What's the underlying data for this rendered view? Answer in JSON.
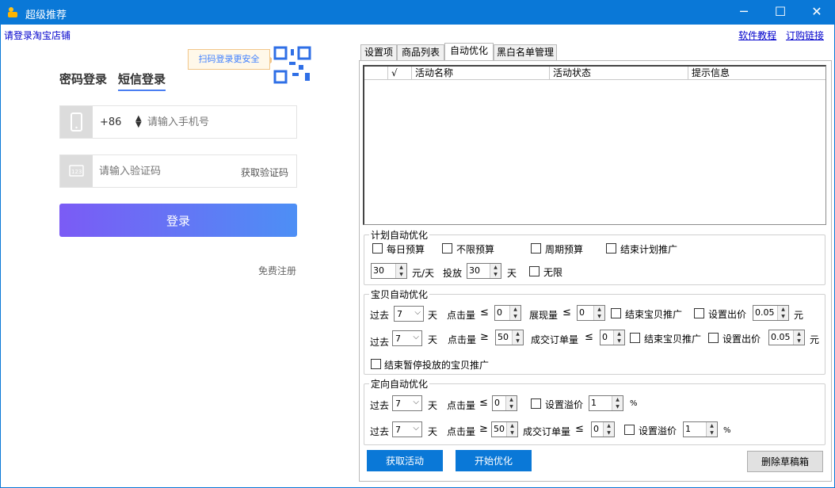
{
  "window": {
    "title": "超级推荐",
    "min": "─",
    "max": "☐",
    "close": "✕"
  },
  "header": {
    "login_link": "请登录淘宝店铺",
    "tutorial": "软件教程",
    "order": "订购链接"
  },
  "login": {
    "qr_tip": "扫码登录更安全",
    "tab_password": "密码登录",
    "tab_sms": "短信登录",
    "country_code": "+86",
    "phone_placeholder": "请输入手机号",
    "code_placeholder": "请输入验证码",
    "get_code": "获取验证码",
    "login_button": "登录",
    "register": "免费注册"
  },
  "tabs": [
    "设置项",
    "商品列表",
    "自动优化",
    "黑白名单管理"
  ],
  "grid": {
    "columns": [
      "",
      "√",
      "活动名称",
      "活动状态",
      "提示信息"
    ]
  },
  "plan": {
    "legend": "计划自动优化",
    "daily_budget": "每日预算",
    "unlimited_budget": "不限预算",
    "cycle_budget": "周期预算",
    "end_plan": "结束计划推广",
    "amount": "30",
    "unit_yuan_day": "元/天",
    "deliver": "投放",
    "days": "30",
    "unit_day": "天",
    "unlimited": "无限"
  },
  "item": {
    "legend": "宝贝自动优化",
    "past": "过去",
    "day": "天",
    "clicks": "点击量",
    "impressions": "展现量",
    "orders": "成交订单量",
    "end_item": "结束宝贝推广",
    "set_bid": "设置出价",
    "yuan": "元",
    "le": "≤",
    "ge": "≥",
    "row1": {
      "days": "7",
      "clicks": "0",
      "impressions": "0",
      "bid": "0.05"
    },
    "row2": {
      "days": "7",
      "clicks": "50",
      "orders": "0",
      "bid": "0.05"
    },
    "end_paused": "结束暂停投放的宝贝推广"
  },
  "target": {
    "legend": "定向自动优化",
    "past": "过去",
    "day": "天",
    "clicks": "点击量",
    "orders": "成交订单量",
    "set_premium": "设置溢价",
    "percent": "%",
    "le": "≤",
    "ge": "≥",
    "row1": {
      "days": "7",
      "clicks": "0",
      "premium": "1"
    },
    "row2": {
      "days": "7",
      "clicks": "50",
      "orders": "0",
      "premium": "1"
    }
  },
  "buttons": {
    "get_activity": "获取活动",
    "start_optimize": "开始优化",
    "delete_drafts": "删除草稿箱"
  }
}
